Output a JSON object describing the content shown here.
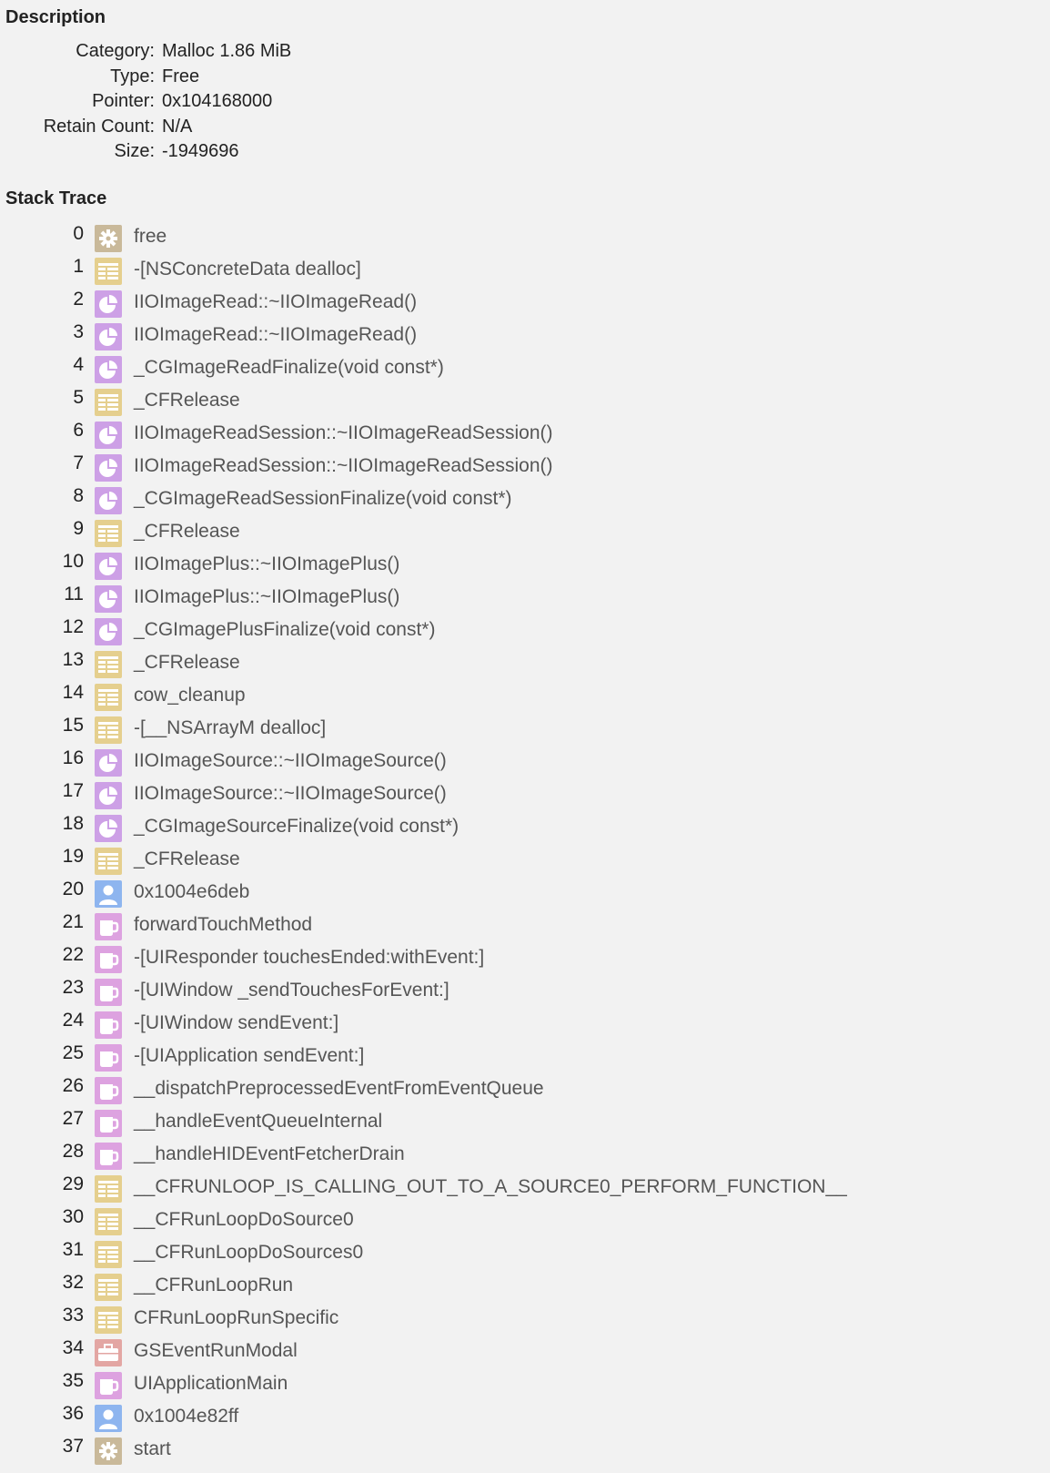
{
  "description": {
    "title": "Description",
    "rows": [
      {
        "key": "Category:",
        "value": "Malloc 1.86 MiB"
      },
      {
        "key": "Type:",
        "value": "Free"
      },
      {
        "key": "Pointer:",
        "value": "0x104168000"
      },
      {
        "key": "Retain Count:",
        "value": "N/A"
      },
      {
        "key": "Size:",
        "value": "-1949696"
      }
    ]
  },
  "stack_trace": {
    "title": "Stack Trace",
    "icon_colors": {
      "gear": "#c9b99a",
      "list": "#e5cf8e",
      "pie": "#cda0e6",
      "user": "#8eb5ef",
      "cup": "#dda2e0",
      "case": "#e3a6a3"
    },
    "frames": [
      {
        "index": "0",
        "icon": "gear-icon",
        "symbol": "free"
      },
      {
        "index": "1",
        "icon": "list-icon",
        "symbol": "-[NSConcreteData dealloc]"
      },
      {
        "index": "2",
        "icon": "pie-icon",
        "symbol": "IIOImageRead::~IIOImageRead()"
      },
      {
        "index": "3",
        "icon": "pie-icon",
        "symbol": "IIOImageRead::~IIOImageRead()"
      },
      {
        "index": "4",
        "icon": "pie-icon",
        "symbol": "_CGImageReadFinalize(void const*)"
      },
      {
        "index": "5",
        "icon": "list-icon",
        "symbol": "_CFRelease"
      },
      {
        "index": "6",
        "icon": "pie-icon",
        "symbol": "IIOImageReadSession::~IIOImageReadSession()"
      },
      {
        "index": "7",
        "icon": "pie-icon",
        "symbol": "IIOImageReadSession::~IIOImageReadSession()"
      },
      {
        "index": "8",
        "icon": "pie-icon",
        "symbol": "_CGImageReadSessionFinalize(void const*)"
      },
      {
        "index": "9",
        "icon": "list-icon",
        "symbol": "_CFRelease"
      },
      {
        "index": "10",
        "icon": "pie-icon",
        "symbol": "IIOImagePlus::~IIOImagePlus()"
      },
      {
        "index": "11",
        "icon": "pie-icon",
        "symbol": "IIOImagePlus::~IIOImagePlus()"
      },
      {
        "index": "12",
        "icon": "pie-icon",
        "symbol": "_CGImagePlusFinalize(void const*)"
      },
      {
        "index": "13",
        "icon": "list-icon",
        "symbol": "_CFRelease"
      },
      {
        "index": "14",
        "icon": "list-icon",
        "symbol": "cow_cleanup"
      },
      {
        "index": "15",
        "icon": "list-icon",
        "symbol": "-[__NSArrayM dealloc]"
      },
      {
        "index": "16",
        "icon": "pie-icon",
        "symbol": "IIOImageSource::~IIOImageSource()"
      },
      {
        "index": "17",
        "icon": "pie-icon",
        "symbol": "IIOImageSource::~IIOImageSource()"
      },
      {
        "index": "18",
        "icon": "pie-icon",
        "symbol": "_CGImageSourceFinalize(void const*)"
      },
      {
        "index": "19",
        "icon": "list-icon",
        "symbol": "_CFRelease"
      },
      {
        "index": "20",
        "icon": "user-icon",
        "symbol": "0x1004e6deb"
      },
      {
        "index": "21",
        "icon": "cup-icon",
        "symbol": "forwardTouchMethod"
      },
      {
        "index": "22",
        "icon": "cup-icon",
        "symbol": "-[UIResponder touchesEnded:withEvent:]"
      },
      {
        "index": "23",
        "icon": "cup-icon",
        "symbol": "-[UIWindow _sendTouchesForEvent:]"
      },
      {
        "index": "24",
        "icon": "cup-icon",
        "symbol": "-[UIWindow sendEvent:]"
      },
      {
        "index": "25",
        "icon": "cup-icon",
        "symbol": "-[UIApplication sendEvent:]"
      },
      {
        "index": "26",
        "icon": "cup-icon",
        "symbol": "__dispatchPreprocessedEventFromEventQueue"
      },
      {
        "index": "27",
        "icon": "cup-icon",
        "symbol": "__handleEventQueueInternal"
      },
      {
        "index": "28",
        "icon": "cup-icon",
        "symbol": "__handleHIDEventFetcherDrain"
      },
      {
        "index": "29",
        "icon": "list-icon",
        "symbol": "__CFRUNLOOP_IS_CALLING_OUT_TO_A_SOURCE0_PERFORM_FUNCTION__"
      },
      {
        "index": "30",
        "icon": "list-icon",
        "symbol": "__CFRunLoopDoSource0"
      },
      {
        "index": "31",
        "icon": "list-icon",
        "symbol": "__CFRunLoopDoSources0"
      },
      {
        "index": "32",
        "icon": "list-icon",
        "symbol": "__CFRunLoopRun"
      },
      {
        "index": "33",
        "icon": "list-icon",
        "symbol": "CFRunLoopRunSpecific"
      },
      {
        "index": "34",
        "icon": "briefcase-icon",
        "symbol": "GSEventRunModal"
      },
      {
        "index": "35",
        "icon": "cup-icon",
        "symbol": "UIApplicationMain"
      },
      {
        "index": "36",
        "icon": "user-icon",
        "symbol": "0x1004e82ff"
      },
      {
        "index": "37",
        "icon": "gear-icon",
        "symbol": "start"
      }
    ]
  }
}
